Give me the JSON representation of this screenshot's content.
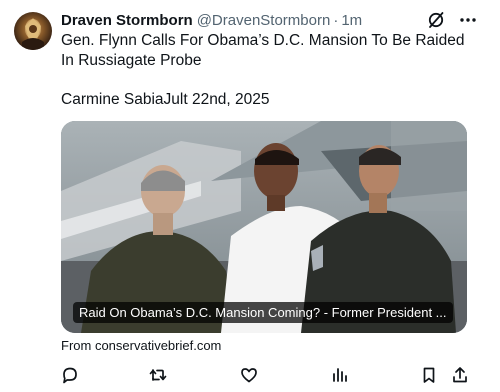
{
  "tweet": {
    "author": {
      "display_name": "Draven Stormborn",
      "handle": "@DravenStormborn",
      "separator": "·",
      "time": "1m"
    },
    "headline": "Gen. Flynn Calls For Obama’s D.C. Mansion To Be Raided In Russiagate Probe",
    "byline": "Carmine SabiaJult 22nd, 2025",
    "card": {
      "caption": "Raid On Obama’s D.C. Mansion Coming? - Former President ...",
      "source": "From conservativebrief.com"
    },
    "header_icons": [
      "grok-icon",
      "more-icon"
    ],
    "actions": [
      "reply-icon",
      "retweet-icon",
      "like-icon",
      "views-icon",
      "bookmark-icon",
      "share-icon"
    ],
    "colors": {
      "text": "#0f1419",
      "secondary": "#536471",
      "background": "#ffffff"
    }
  }
}
